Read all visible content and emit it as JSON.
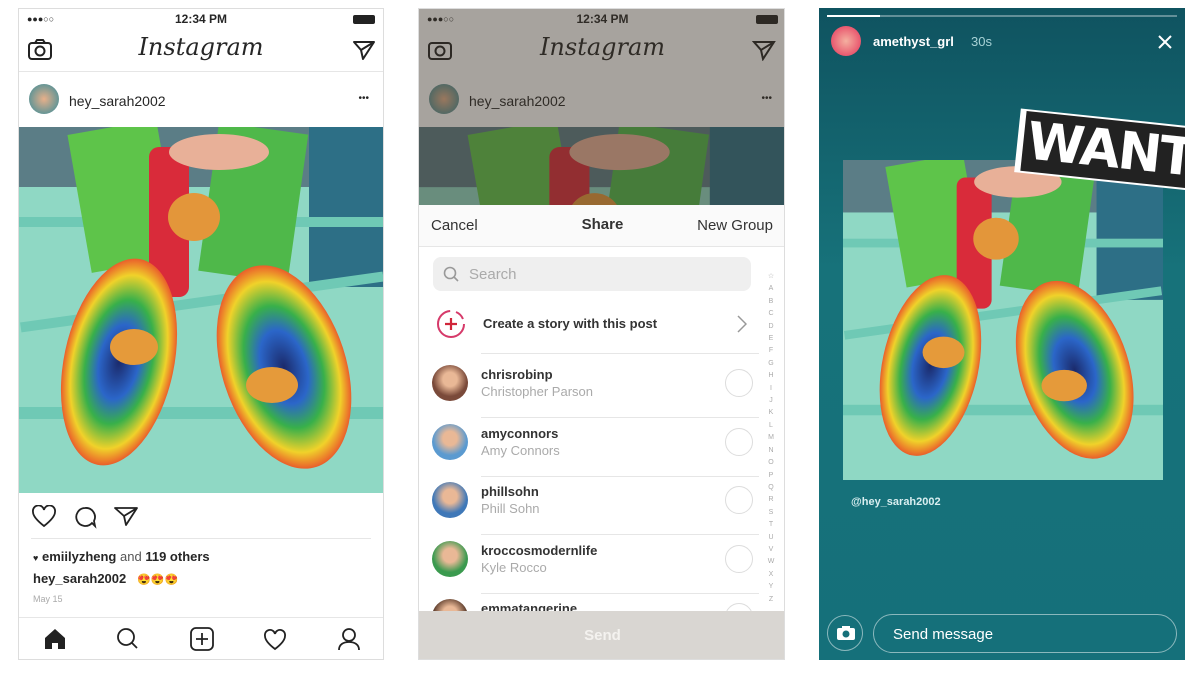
{
  "feed": {
    "status": {
      "carrier": "●●●○○",
      "time": "12:34 PM"
    },
    "app_title": "Instagram",
    "post": {
      "username": "hey_sarah2002",
      "more": "•••",
      "likes_user": "emiilyzheng",
      "likes_and": "and",
      "likes_others": "119 others",
      "caption_user": "hey_sarah2002",
      "caption_text": "😍😍😍",
      "date": "May 15"
    },
    "nav": [
      "home-icon",
      "search-icon",
      "add-icon",
      "heart-icon",
      "profile-icon"
    ]
  },
  "share": {
    "status": {
      "carrier": "●●●○○",
      "time": "12:34 PM"
    },
    "app_title": "Instagram",
    "post_username": "hey_sarah2002",
    "more": "•••",
    "cancel": "Cancel",
    "title": "Share",
    "new_group": "New Group",
    "search_placeholder": "Search",
    "create_story": "Create a story with this post",
    "contacts": [
      {
        "username": "chrisrobinp",
        "name": "Christopher Parson",
        "color": "#7a4a3a"
      },
      {
        "username": "amyconnors",
        "name": "Amy Connors",
        "color": "#5b9ad0"
      },
      {
        "username": "phillsohn",
        "name": "Phill Sohn",
        "color": "#3f78b8"
      },
      {
        "username": "kroccosmodernlife",
        "name": "Kyle Rocco",
        "color": "#3b9a4f"
      },
      {
        "username": "emmatangerine",
        "name": "",
        "color": "#5a3a2a"
      }
    ],
    "index": [
      "☆",
      "A",
      "B",
      "C",
      "D",
      "E",
      "F",
      "G",
      "H",
      "I",
      "J",
      "K",
      "L",
      "M",
      "N",
      "O",
      "P",
      "Q",
      "R",
      "S",
      "T",
      "U",
      "V",
      "W",
      "X",
      "Y",
      "Z"
    ],
    "send": "Send"
  },
  "story": {
    "progress": 0.15,
    "username": "amethyst_grl",
    "time": "30s",
    "sticker": "WANT",
    "mention": "@hey_sarah2002",
    "message_placeholder": "Send message",
    "bg_color": "#15707a"
  }
}
